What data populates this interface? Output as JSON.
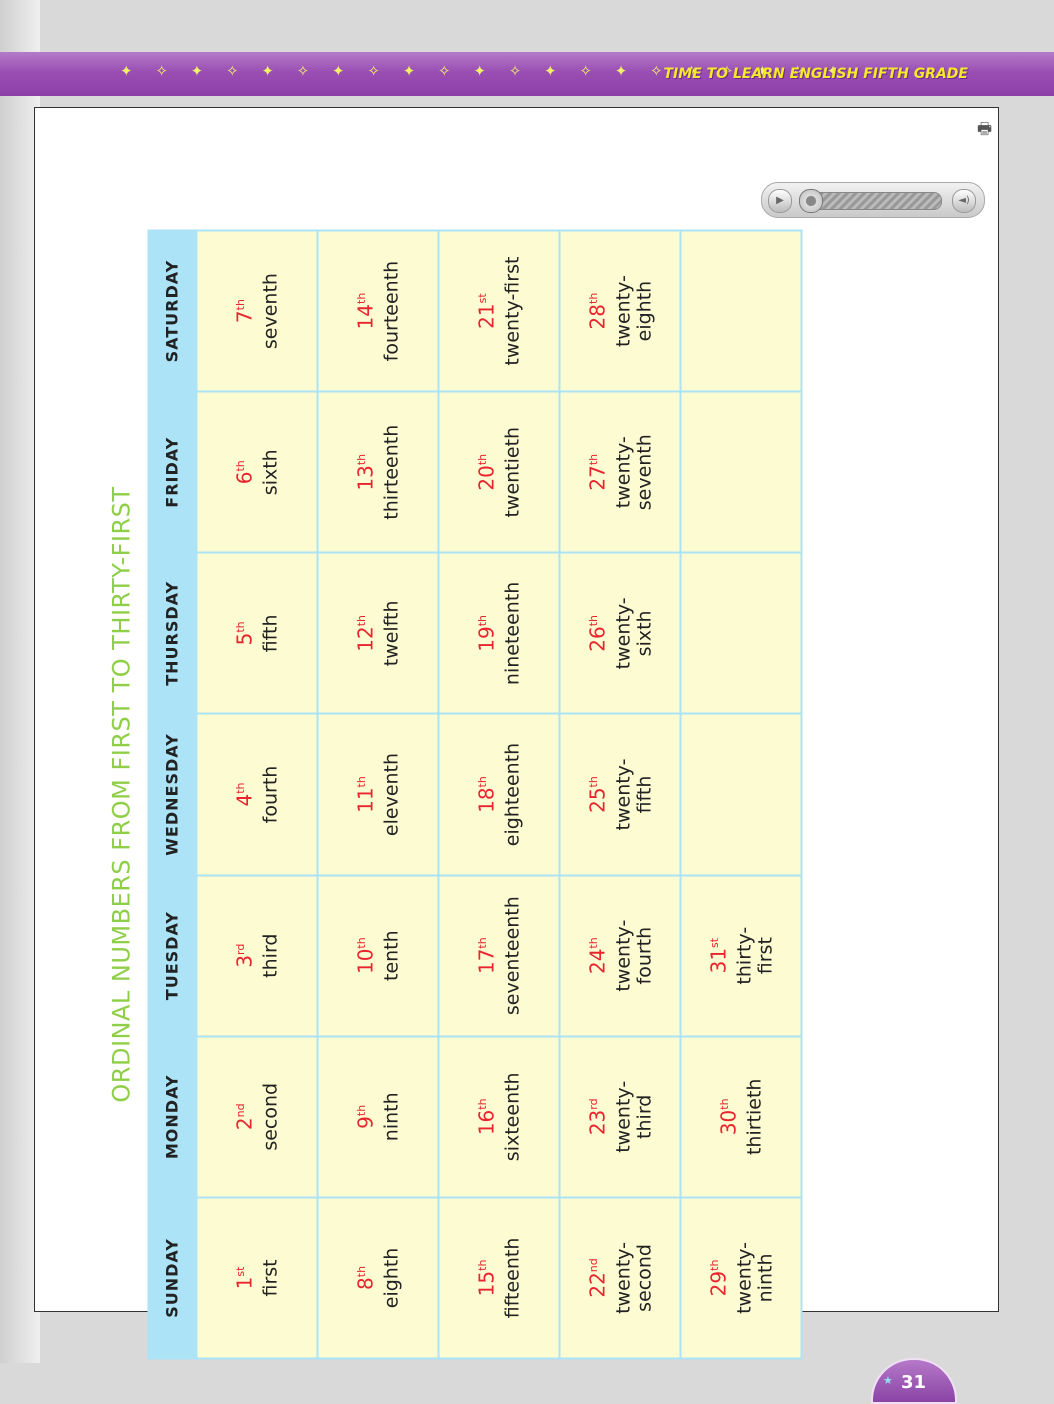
{
  "header": {
    "title": "TIME TO LEARN ENGLISH FIFTH GRADE",
    "stars": "✦ ✧ ✦ ✧ ✦ ✧ ✦ ✧ ✦ ✧ ✦ ✧ ✦ ✧ ✦ ✧ ✦ ✧ ✦ ✧ ✦"
  },
  "toolbar": {
    "print_icon": "print-icon",
    "play_icon": "▶",
    "volume_icon": "◄)"
  },
  "page": {
    "title": "ORDINAL NUMBERS FROM FIRST TO THIRTY-FIRST",
    "page_number": "31",
    "days": [
      "SUNDAY",
      "MONDAY",
      "TUESDAY",
      "WEDNESDAY",
      "THURSDAY",
      "FRIDAY",
      "SATURDAY"
    ],
    "weeks": [
      [
        {
          "n": "1",
          "suf": "st",
          "w": "first"
        },
        {
          "n": "2",
          "suf": "nd",
          "w": "second"
        },
        {
          "n": "3",
          "suf": "rd",
          "w": "third"
        },
        {
          "n": "4",
          "suf": "th",
          "w": "fourth"
        },
        {
          "n": "5",
          "suf": "th",
          "w": "fifth"
        },
        {
          "n": "6",
          "suf": "th",
          "w": "sixth"
        },
        {
          "n": "7",
          "suf": "th",
          "w": "seventh"
        }
      ],
      [
        {
          "n": "8",
          "suf": "th",
          "w": "eighth"
        },
        {
          "n": "9",
          "suf": "th",
          "w": "ninth"
        },
        {
          "n": "10",
          "suf": "th",
          "w": "tenth"
        },
        {
          "n": "11",
          "suf": "th",
          "w": "eleventh"
        },
        {
          "n": "12",
          "suf": "th",
          "w": "twelfth"
        },
        {
          "n": "13",
          "suf": "th",
          "w": "thirteenth"
        },
        {
          "n": "14",
          "suf": "th",
          "w": "fourteenth"
        }
      ],
      [
        {
          "n": "15",
          "suf": "th",
          "w": "fifteenth"
        },
        {
          "n": "16",
          "suf": "th",
          "w": "sixteenth"
        },
        {
          "n": "17",
          "suf": "th",
          "w": "seventeenth"
        },
        {
          "n": "18",
          "suf": "th",
          "w": "eighteenth"
        },
        {
          "n": "19",
          "suf": "th",
          "w": "nineteenth"
        },
        {
          "n": "20",
          "suf": "th",
          "w": "twentieth"
        },
        {
          "n": "21",
          "suf": "st",
          "w": "twenty-first"
        }
      ],
      [
        {
          "n": "22",
          "suf": "nd",
          "w": "twenty-\nsecond"
        },
        {
          "n": "23",
          "suf": "rd",
          "w": "twenty-\nthird"
        },
        {
          "n": "24",
          "suf": "th",
          "w": "twenty-\nfourth"
        },
        {
          "n": "25",
          "suf": "th",
          "w": "twenty-\nfifth"
        },
        {
          "n": "26",
          "suf": "th",
          "w": "twenty-\nsixth"
        },
        {
          "n": "27",
          "suf": "th",
          "w": "twenty-\nseventh"
        },
        {
          "n": "28",
          "suf": "th",
          "w": "twenty-\neighth"
        }
      ],
      [
        {
          "n": "29",
          "suf": "th",
          "w": "twenty-\nninth"
        },
        {
          "n": "30",
          "suf": "th",
          "w": "thirtieth"
        },
        {
          "n": "31",
          "suf": "st",
          "w": "thirty-\nfirst"
        },
        null,
        null,
        null,
        null
      ]
    ]
  },
  "colors": {
    "title": "#8fcf47",
    "number": "#e8242f",
    "cell": "#fcfbd1",
    "grid": "#ade3f6",
    "banner": "#9a4fb3"
  }
}
